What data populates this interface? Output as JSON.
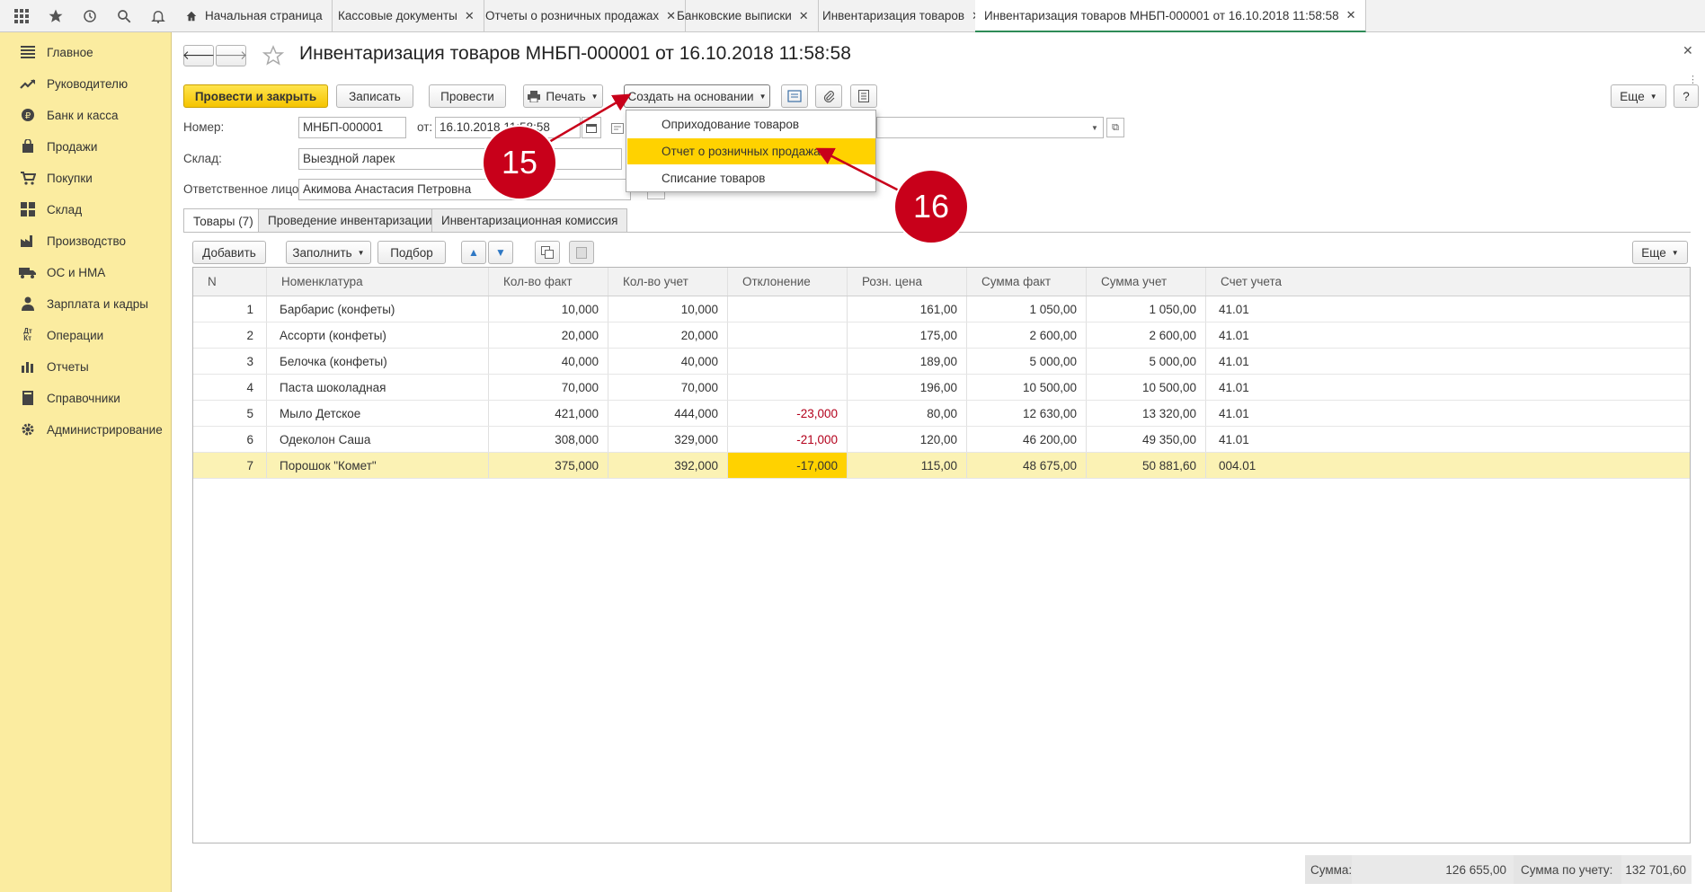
{
  "tabs": [
    {
      "label": "Начальная страница",
      "closable": false
    },
    {
      "label": "Кассовые документы",
      "closable": true
    },
    {
      "label": "Отчеты о розничных продажах",
      "closable": true
    },
    {
      "label": "Банковские выписки",
      "closable": true
    },
    {
      "label": "Инвентаризация товаров",
      "closable": true
    },
    {
      "label": "Инвентаризация товаров МНБП-000001 от 16.10.2018 11:58:58",
      "closable": true
    }
  ],
  "sidebar": {
    "items": [
      {
        "label": "Главное",
        "icon": "menu-icon"
      },
      {
        "label": "Руководителю",
        "icon": "trend-icon"
      },
      {
        "label": "Банк и касса",
        "icon": "coin-icon"
      },
      {
        "label": "Продажи",
        "icon": "bag-icon"
      },
      {
        "label": "Покупки",
        "icon": "cart-icon"
      },
      {
        "label": "Склад",
        "icon": "grid-icon"
      },
      {
        "label": "Производство",
        "icon": "factory-icon"
      },
      {
        "label": "ОС и НМА",
        "icon": "truck-icon"
      },
      {
        "label": "Зарплата и кадры",
        "icon": "person-icon"
      },
      {
        "label": "Операции",
        "icon": "dt-kt-icon"
      },
      {
        "label": "Отчеты",
        "icon": "bar-chart-icon"
      },
      {
        "label": "Справочники",
        "icon": "book-icon"
      },
      {
        "label": "Администрирование",
        "icon": "gear-icon"
      }
    ]
  },
  "document": {
    "title": "Инвентаризация товаров МНБП-000001 от 16.10.2018 11:58:58"
  },
  "toolbar": {
    "post_and_close": "Провести и закрыть",
    "save": "Записать",
    "post": "Провести",
    "print": "Печать",
    "create_based_on": "Создать на основании",
    "more": "Еще",
    "help": "?"
  },
  "form": {
    "number_label": "Номер:",
    "number_value": "МНБП-000001",
    "from_label": "от:",
    "date_value": "16.10.2018 11:58:58",
    "warehouse_label": "Склад:",
    "warehouse_value": "Выездной ларек",
    "responsible_label": "Ответственное лицо:",
    "responsible_value": "Акимова Анастасия Петровна"
  },
  "create_menu": {
    "items": [
      {
        "label": "Оприходование товаров"
      },
      {
        "label": "Отчет о розничных продажах"
      },
      {
        "label": "Списание товаров"
      }
    ]
  },
  "subtabs": [
    {
      "label": "Товары (7)"
    },
    {
      "label": "Проведение инвентаризации"
    },
    {
      "label": "Инвентаризационная комиссия"
    }
  ],
  "table_toolbar": {
    "add": "Добавить",
    "fill": "Заполнить",
    "pick": "Подбор",
    "more": "Еще"
  },
  "table": {
    "columns": [
      "N",
      "Номенклатура",
      "Кол-во факт",
      "Кол-во учет",
      "Отклонение",
      "Розн. цена",
      "Сумма факт",
      "Сумма учет",
      "Счет учета"
    ],
    "rows": [
      {
        "n": "1",
        "name": "Барбарис (конфеты)",
        "qty_fact": "10,000",
        "qty_acc": "10,000",
        "dev": "",
        "price": "161,00",
        "sum_fact": "1 050,00",
        "sum_acc": "1 050,00",
        "account": "41.01"
      },
      {
        "n": "2",
        "name": "Ассорти (конфеты)",
        "qty_fact": "20,000",
        "qty_acc": "20,000",
        "dev": "",
        "price": "175,00",
        "sum_fact": "2 600,00",
        "sum_acc": "2 600,00",
        "account": "41.01"
      },
      {
        "n": "3",
        "name": "Белочка (конфеты)",
        "qty_fact": "40,000",
        "qty_acc": "40,000",
        "dev": "",
        "price": "189,00",
        "sum_fact": "5 000,00",
        "sum_acc": "5 000,00",
        "account": "41.01"
      },
      {
        "n": "4",
        "name": "Паста шоколадная",
        "qty_fact": "70,000",
        "qty_acc": "70,000",
        "dev": "",
        "price": "196,00",
        "sum_fact": "10 500,00",
        "sum_acc": "10 500,00",
        "account": "41.01"
      },
      {
        "n": "5",
        "name": "Мыло Детское",
        "qty_fact": "421,000",
        "qty_acc": "444,000",
        "dev": "-23,000",
        "price": "80,00",
        "sum_fact": "12 630,00",
        "sum_acc": "13 320,00",
        "account": "41.01"
      },
      {
        "n": "6",
        "name": "Одеколон Саша",
        "qty_fact": "308,000",
        "qty_acc": "329,000",
        "dev": "-21,000",
        "price": "120,00",
        "sum_fact": "46 200,00",
        "sum_acc": "49 350,00",
        "account": "41.01"
      },
      {
        "n": "7",
        "name": "Порошок \"Комет\"",
        "qty_fact": "375,000",
        "qty_acc": "392,000",
        "dev": "-17,000",
        "price": "115,00",
        "sum_fact": "48 675,00",
        "sum_acc": "50 881,60",
        "account": "004.01"
      }
    ]
  },
  "totals": {
    "sum_label": "Сумма:",
    "sum_value": "126 655,00",
    "sum_acc_label": "Сумма по учету:",
    "sum_acc_value": "132 701,60"
  },
  "annotations": [
    {
      "label": "15"
    },
    {
      "label": "16"
    }
  ],
  "colors": {
    "sidebar_bg": "#fbeca0",
    "primary_button": "#f5c400",
    "highlight": "#ffd200",
    "marker": "#c8001a",
    "negative": "#b3001b"
  }
}
